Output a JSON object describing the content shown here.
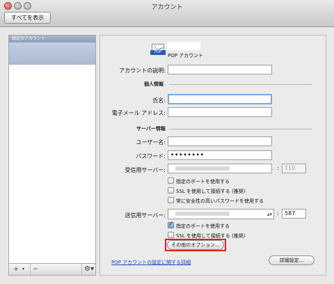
{
  "window": {
    "title": "アカウント"
  },
  "toolbar": {
    "show_all_label": "すべてを表示"
  },
  "sidebar": {
    "header": "既定のアカウント",
    "add_label": "+",
    "add_menu_caret": "▾",
    "remove_label": "−",
    "gear_label": "⚙▾"
  },
  "account": {
    "type_label": "POP アカウント",
    "icon": "mail-envelope-icon",
    "icon_tag": "POP"
  },
  "fields": {
    "description": {
      "label": "アカウントの説明:",
      "value": ""
    },
    "personal_section": "個人情報",
    "full_name": {
      "label": "氏名:",
      "value": ""
    },
    "email": {
      "label": "電子メール アドレス:",
      "value": ""
    },
    "server_section": "サーバー情報",
    "username": {
      "label": "ユーザー名:",
      "value": ""
    },
    "password": {
      "label": "パスワード:",
      "value": "••••••••"
    },
    "incoming_server": {
      "label": "受信用サーバー:",
      "port": "110"
    },
    "outgoing_server": {
      "label": "送信用サーバー:",
      "port": "587"
    },
    "port_separator": ":"
  },
  "incoming_options": [
    {
      "label": "指定のポートを使用する",
      "checked": false
    },
    {
      "label": "SSL を使用して接続する (推奨)",
      "checked": false
    },
    {
      "label": "常に安全性の高いパスワードを使用する",
      "checked": false
    }
  ],
  "outgoing_options": [
    {
      "label": "指定のポートを使用する",
      "checked": true
    },
    {
      "label": "SSL を使用して接続する (推奨)",
      "checked": false
    }
  ],
  "buttons": {
    "more_options": "その他のオプション...",
    "advanced": "詳細設定..."
  },
  "link": {
    "text": "POP アカウントの設定に関する詳細"
  },
  "colors": {
    "highlight": "#e0201a",
    "link": "#1c45b8",
    "focus_ring": "#7aa7e0"
  }
}
